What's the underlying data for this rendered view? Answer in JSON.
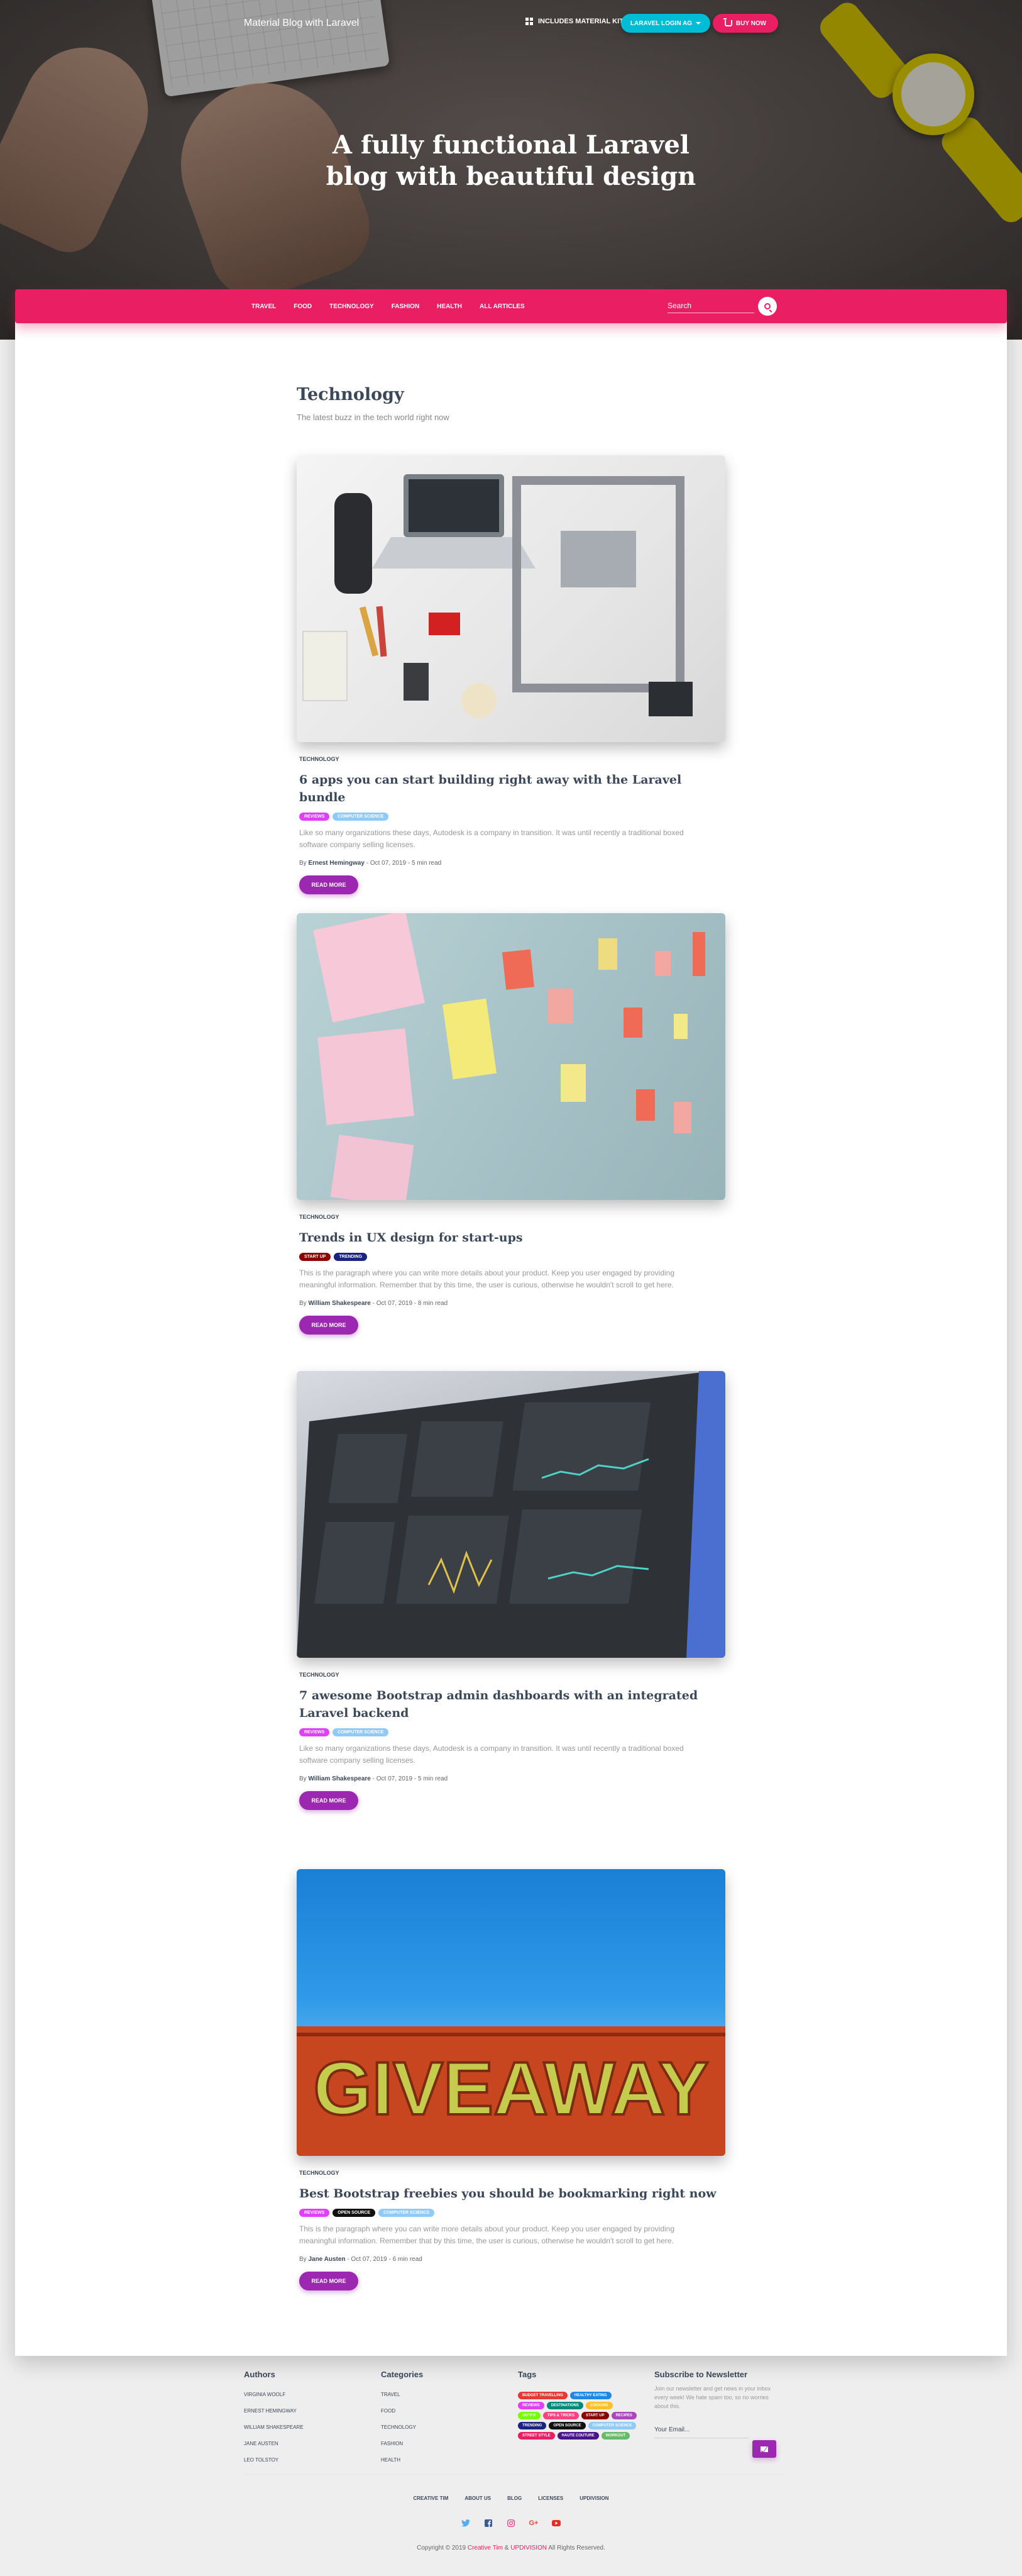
{
  "header": {
    "brand": "Material Blog with Laravel",
    "nav_item": "INCLUDES MATERIAL KIT PRO",
    "laravel_button": "LARAVEL LOGIN AG",
    "buy_button": "BUY NOW",
    "hero_title_line1": "A fully functional Laravel",
    "hero_title_line2": "blog with beautiful design"
  },
  "nav": {
    "links": [
      "TRAVEL",
      "FOOD",
      "TECHNOLOGY",
      "FASHION",
      "HEALTH",
      "ALL ARTICLES"
    ],
    "search_placeholder": "Search"
  },
  "section": {
    "title": "Technology",
    "subtitle": "The latest buzz in the tech world right now"
  },
  "articles": [
    {
      "category": "TECHNOLOGY",
      "title": "6 apps you can start building right away with the Laravel bundle",
      "badges": [
        {
          "label": "REVIEWS",
          "color": "#e040fb"
        },
        {
          "label": "COMPUTER SCIENCE",
          "color": "#90caf9"
        }
      ],
      "excerpt": "Like so many organizations these days, Autodesk is a company in transition. It was until recently a traditional boxed software company selling licenses.",
      "by": "By",
      "author": "Ernest Hemingway",
      "date": "- Oct 07, 2019 - 5 min read",
      "button": "READ MORE"
    },
    {
      "category": "TECHNOLOGY",
      "title": "Trends in UX design for start-ups",
      "badges": [
        {
          "label": "START UP",
          "color": "#8b0000"
        },
        {
          "label": "TRENDING",
          "color": "#1a237e"
        }
      ],
      "excerpt": "This is the paragraph where you can write more details about your product. Keep you user engaged by providing meaningful information. Remember that by this time, the user is curious, otherwise he wouldn't scroll to get here.",
      "by": "By",
      "author": "William Shakespeare",
      "date": "- Oct 07, 2019 - 8 min read",
      "button": "READ MORE"
    },
    {
      "category": "TECHNOLOGY",
      "title": "7 awesome Bootstrap admin dashboards with an integrated Laravel backend",
      "badges": [
        {
          "label": "REVIEWS",
          "color": "#e040fb"
        },
        {
          "label": "COMPUTER SCIENCE",
          "color": "#90caf9"
        }
      ],
      "excerpt": "Like so many organizations these days, Autodesk is a company in transition. It was until recently a traditional boxed software company selling licenses.",
      "by": "By",
      "author": "William Shakespeare",
      "date": "- Oct 07, 2019 - 5 min read",
      "button": "READ MORE"
    },
    {
      "category": "TECHNOLOGY",
      "title": "Best Bootstrap freebies you should be bookmarking right now",
      "badges": [
        {
          "label": "REVIEWS",
          "color": "#e040fb"
        },
        {
          "label": "OPEN SOURCE",
          "color": "#111111"
        },
        {
          "label": "COMPUTER SCIENCE",
          "color": "#90caf9"
        }
      ],
      "excerpt": "This is the paragraph where you can write more details about your product. Keep you user engaged by providing meaningful information. Remember that by this time, the user is curious, otherwise he wouldn't scroll to get here.",
      "by": "By",
      "author": "Jane Austen",
      "date": "- Oct 07, 2019 - 6 min read",
      "button": "READ MORE",
      "sign_text": "GIVEAWAY"
    }
  ],
  "footer": {
    "authors_title": "Authors",
    "authors": [
      "VIRGINIA WOOLF",
      "ERNEST HEMINGWAY",
      "WILLIAM SHAKESPEARE",
      "JANE AUSTEN",
      "LEO TOLSTOY"
    ],
    "categories_title": "Categories",
    "categories": [
      "TRAVEL",
      "FOOD",
      "TECHNOLOGY",
      "FASHION",
      "HEALTH"
    ],
    "tags_title": "Tags",
    "tags": [
      {
        "label": "BUDGET TRAVELLING",
        "color": "#e53935"
      },
      {
        "label": "HEALTHY EATING",
        "color": "#1e88e5"
      },
      {
        "label": "REVIEWS",
        "color": "#e040fb"
      },
      {
        "label": "DESTINATIONS",
        "color": "#00897b"
      },
      {
        "label": "COOKING",
        "color": "#fbc02d"
      },
      {
        "label": "OUTFIT",
        "color": "#76ff03"
      },
      {
        "label": "TIPS & TRICKS",
        "color": "#ff4081"
      },
      {
        "label": "START UP",
        "color": "#8b0000"
      },
      {
        "label": "RECIPES",
        "color": "#ab47bc"
      },
      {
        "label": "TRENDING",
        "color": "#1a237e"
      },
      {
        "label": "OPEN SOURCE",
        "color": "#111111"
      },
      {
        "label": "COMPUTER SCIENCE",
        "color": "#90caf9"
      },
      {
        "label": "STREET STYLE",
        "color": "#e91e63"
      },
      {
        "label": "HAUTE COUTURE",
        "color": "#4a148c"
      },
      {
        "label": "WORKOUT",
        "color": "#66bb6a"
      }
    ],
    "newsletter_title": "Subscribe to Newsletter",
    "newsletter_text": "Join our newsletter and get news in your inbox every week! We hate spam too, so no worries about this.",
    "email_placeholder": "Your Email...",
    "bottom_links": [
      "CREATIVE TIM",
      "ABOUT US",
      "BLOG",
      "LICENSES",
      "UPDIVISION"
    ],
    "copyright_prefix": "Copyright © 2019",
    "copyright_ct": "Creative Tim",
    "copyright_amp": "&",
    "copyright_ud": "UPDIVISION",
    "copyright_suffix": "All Rights Reserved."
  }
}
